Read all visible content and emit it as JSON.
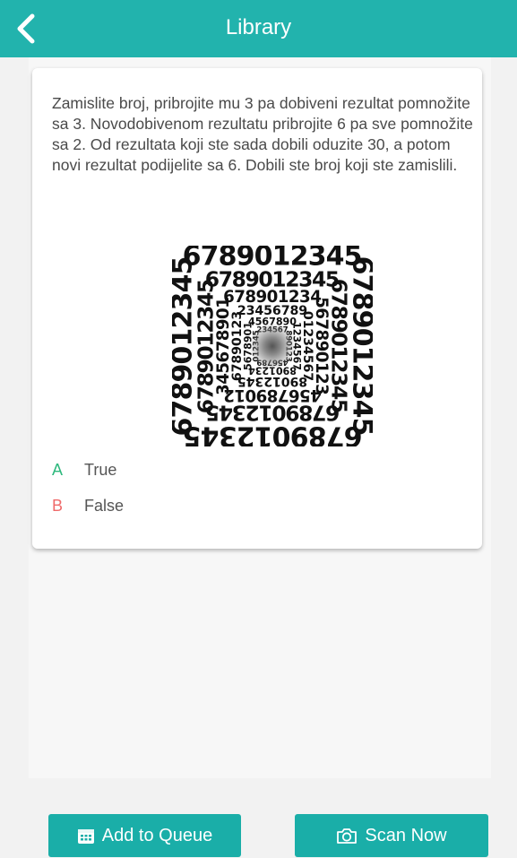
{
  "header": {
    "title": "Library",
    "back_icon": "chevron-left-icon"
  },
  "question": {
    "text": "Zamislite broj, pribrojite mu 3 pa dobiveni rezultat pomnožite sa 3.  Novodobivenom rezultatu pribrojite 6 pa sve pomnožite sa 2. Od rezultata koji ste sada dobili oduzite 30, a potom novi rezultat podijelite sa 6. Dobili ste broj koji ste zamislili."
  },
  "illusion_digits": "6789012345",
  "answers": [
    {
      "letter": "A",
      "label": "True",
      "color": "#2db87d"
    },
    {
      "letter": "B",
      "label": "False",
      "color": "#ef6a6a"
    }
  ],
  "actions": {
    "add_queue_label": "Add to Queue",
    "add_queue_icon": "calendar-icon",
    "scan_label": "Scan Now",
    "scan_icon": "camera-icon"
  },
  "colors": {
    "accent": "#22b3ad",
    "button": "#1aaea8"
  }
}
